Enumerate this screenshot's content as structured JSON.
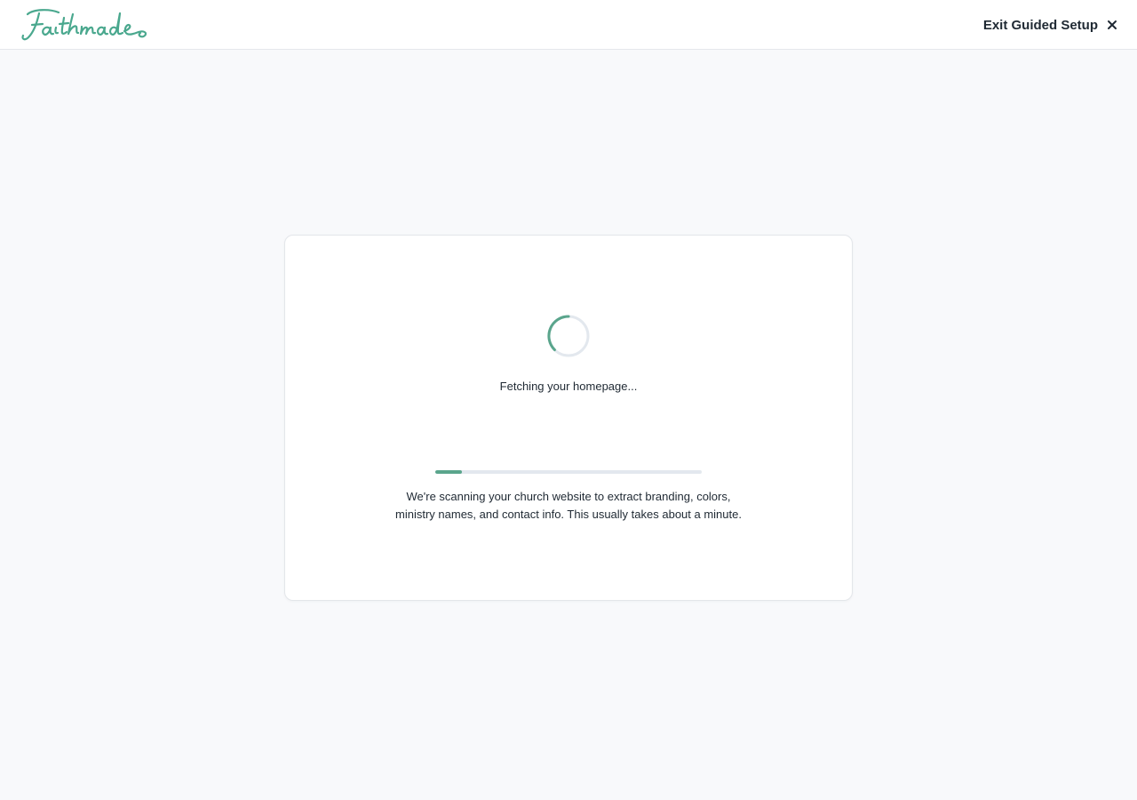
{
  "header": {
    "logo_text": "Faithmade",
    "exit_label": "Exit Guided Setup",
    "exit_icon": "close-icon"
  },
  "loader": {
    "status": "Fetching your homepage...",
    "progress": 0.1,
    "description": "We're scanning your church website to extract branding, colors, ministry names, and contact info. This usually takes about a minute."
  },
  "colors": {
    "brand": "#4aa88e",
    "accent": "#5aa58c",
    "track": "#e3e8ee",
    "background": "#f8f9fb"
  }
}
